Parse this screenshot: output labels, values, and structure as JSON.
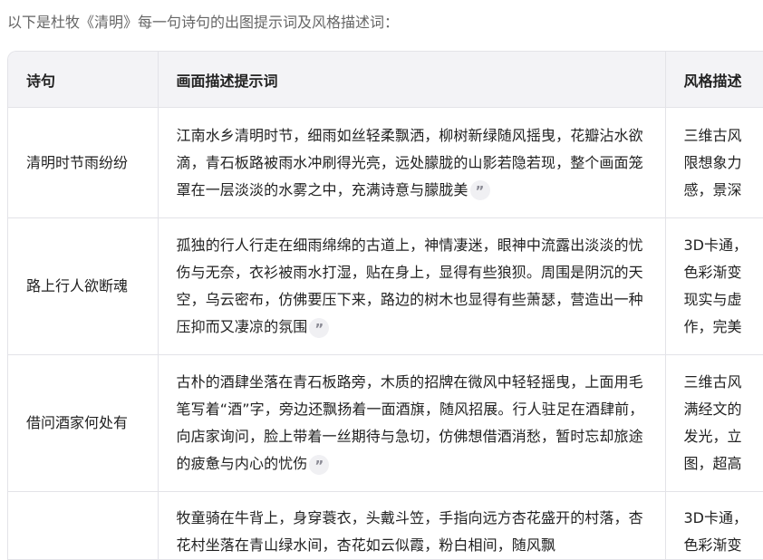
{
  "intro_text": "以下是杜牧《清明》每一句诗句的出图提示词及风格描述词：",
  "table": {
    "headers": [
      "诗句",
      "画面描述提示词",
      "风格描述"
    ],
    "rows": [
      {
        "poem": "清明时节雨纷纷",
        "description": "江南水乡清明时节，细雨如丝轻柔飘洒，柳树新绿随风摇曳，花瓣沾水欲滴，青石板路被雨水冲刷得光亮，远处朦胧的山影若隐若现，整个画面笼罩在一层淡淡的水雾之中，充满诗意与朦胧美",
        "style": "三维古风\n限想象力\n感，景深"
      },
      {
        "poem": "路上行人欲断魂",
        "description": "孤独的行人行走在细雨绵绵的古道上，神情凄迷，眼神中流露出淡淡的忧伤与无奈，衣衫被雨水打湿，贴在身上，显得有些狼狈。周围是阴沉的天空，乌云密布，仿佛要压下来，路边的树木也显得有些萧瑟，营造出一种压抑而又凄凉的氛围",
        "style": "3D卡通，\n色彩渐变\n现实与虚\n作，完美"
      },
      {
        "poem": "借问酒家何处有",
        "description": "古朴的酒肆坐落在青石板路旁，木质的招牌在微风中轻轻摇曳，上面用毛笔写着“酒”字，旁边还飘扬着一面酒旗，随风招展。行人驻足在酒肆前，向店家询问，脸上带着一丝期待与急切，仿佛想借酒消愁，暂时忘却旅途的疲惫与内心的忧伤",
        "style": "三维古风\n满经文的\n发光，立\n图，超高"
      },
      {
        "poem": "",
        "description": "牧童骑在牛背上，身穿蓑衣，头戴斗笠，手指向远方杏花盛开的村落，杏花村坐落在青山绿水间，杏花如云似霞，粉白相间，随风飘",
        "style": "3D卡通，\n色彩渐变"
      }
    ]
  },
  "icons": {
    "quote": "quote-icon"
  }
}
